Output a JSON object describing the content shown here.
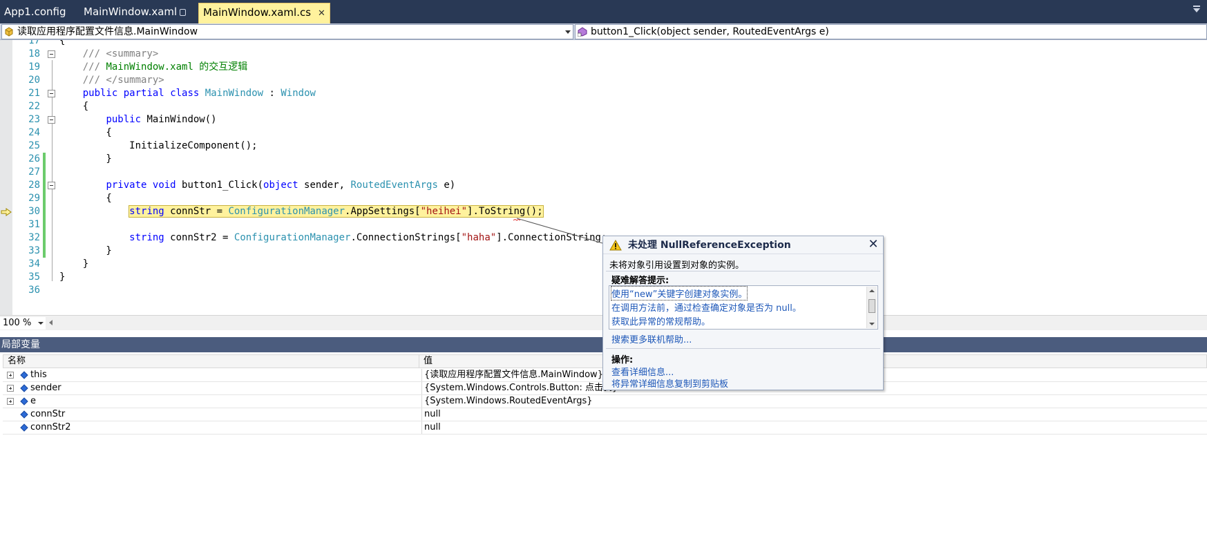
{
  "tabs": [
    {
      "label": "App1.config"
    },
    {
      "label": "MainWindow.xaml"
    },
    {
      "label": "MainWindow.xaml.cs"
    }
  ],
  "tab_close_glyph": "✕",
  "navbar": {
    "type_combo": "读取应用程序配置文件信息.MainWindow",
    "member_combo": "button1_Click(object sender, RoutedEventArgs e)"
  },
  "code_lines": [
    {
      "num": "17",
      "text": "{"
    },
    {
      "num": "18",
      "text": "    /// <summary>"
    },
    {
      "num": "19",
      "text": "    /// MainWindow.xaml 的交互逻辑"
    },
    {
      "num": "20",
      "text": "    /// </summary>"
    },
    {
      "num": "21",
      "text": "    public partial class MainWindow : Window"
    },
    {
      "num": "22",
      "text": "    {"
    },
    {
      "num": "23",
      "text": "        public MainWindow()"
    },
    {
      "num": "24",
      "text": "        {"
    },
    {
      "num": "25",
      "text": "            InitializeComponent();"
    },
    {
      "num": "26",
      "text": "        }"
    },
    {
      "num": "27",
      "text": ""
    },
    {
      "num": "28",
      "text": "        private void button1_Click(object sender, RoutedEventArgs e)"
    },
    {
      "num": "29",
      "text": "        {"
    },
    {
      "num": "30",
      "text": "            string connStr = ConfigurationManager.AppSettings[\"heihei\"].ToString();"
    },
    {
      "num": "31",
      "text": ""
    },
    {
      "num": "32",
      "text": "            string connStr2 = ConfigurationManager.ConnectionStrings[\"haha\"].ConnectionString;"
    },
    {
      "num": "33",
      "text": "        }"
    },
    {
      "num": "34",
      "text": "    }"
    },
    {
      "num": "35",
      "text": "}"
    },
    {
      "num": "36",
      "text": ""
    }
  ],
  "zoom": {
    "value": "100 %"
  },
  "locals": {
    "title": "局部变量",
    "columns": {
      "name": "名称",
      "value": "值"
    },
    "rows": [
      {
        "name": "this",
        "value": "{读取应用程序配置文件信息.MainWindow}",
        "expandable": true
      },
      {
        "name": "sender",
        "value": "{System.Windows.Controls.Button: 点击我}",
        "expandable": true
      },
      {
        "name": "e",
        "value": "{System.Windows.RoutedEventArgs}",
        "expandable": true
      },
      {
        "name": "connStr",
        "value": "null",
        "expandable": false
      },
      {
        "name": "connStr2",
        "value": "null",
        "expandable": false
      }
    ]
  },
  "exception": {
    "title": "未处理 NullReferenceException",
    "message": "未将对象引用设置到对象的实例。",
    "tips_label": "疑难解答提示:",
    "tips": [
      "使用“new”关键字创建对象实例。",
      "在调用方法前，通过检查确定对象是否为 null。",
      "获取此异常的常规帮助。"
    ],
    "search_link": "搜索更多联机帮助...",
    "actions_label": "操作:",
    "actions": [
      "查看详细信息...",
      "将异常详细信息复制到剪贴板"
    ]
  },
  "colors": {
    "tabstrip_bg": "#293955",
    "active_tab_bg": "#fff29d",
    "current_statement_highlight": "#fff29d",
    "change_bar": "#6ccb6c",
    "keyword": "#0000ff",
    "type": "#2b91af",
    "comment": "#008000",
    "string": "#a31515",
    "link": "#1d57b8"
  }
}
